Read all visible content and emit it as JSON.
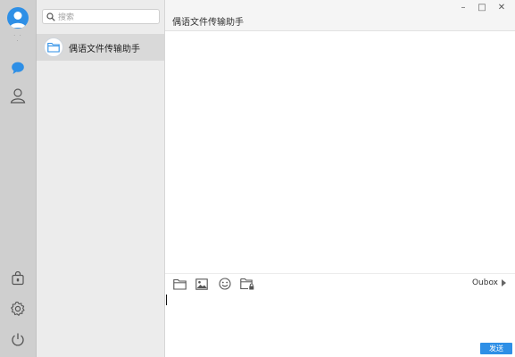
{
  "sidebar": {
    "icons": [
      "avatar-icon",
      "chat-bubble-icon",
      "contacts-icon",
      "lock-file-icon",
      "gear-icon",
      "power-icon"
    ]
  },
  "search": {
    "placeholder": "搜索"
  },
  "sessions": [
    {
      "name": "偶语文件传输助手",
      "icon": "folder-icon",
      "selected": true
    }
  ],
  "chat": {
    "title": "偶语文件传输助手",
    "window_controls": {
      "minimize": "–",
      "maximize": "□",
      "close": "✕"
    },
    "toolbar": {
      "icons": [
        "folder-icon",
        "image-icon",
        "emoji-icon",
        "folder-lock-icon"
      ],
      "outbox_label": "Oubox"
    },
    "input_value": "",
    "send_label": "发送"
  },
  "colors": {
    "accent": "#2e8fe6",
    "rail_bg": "#cfcfcf",
    "list_bg": "#ececec",
    "selected_bg": "#d9d9d9"
  }
}
